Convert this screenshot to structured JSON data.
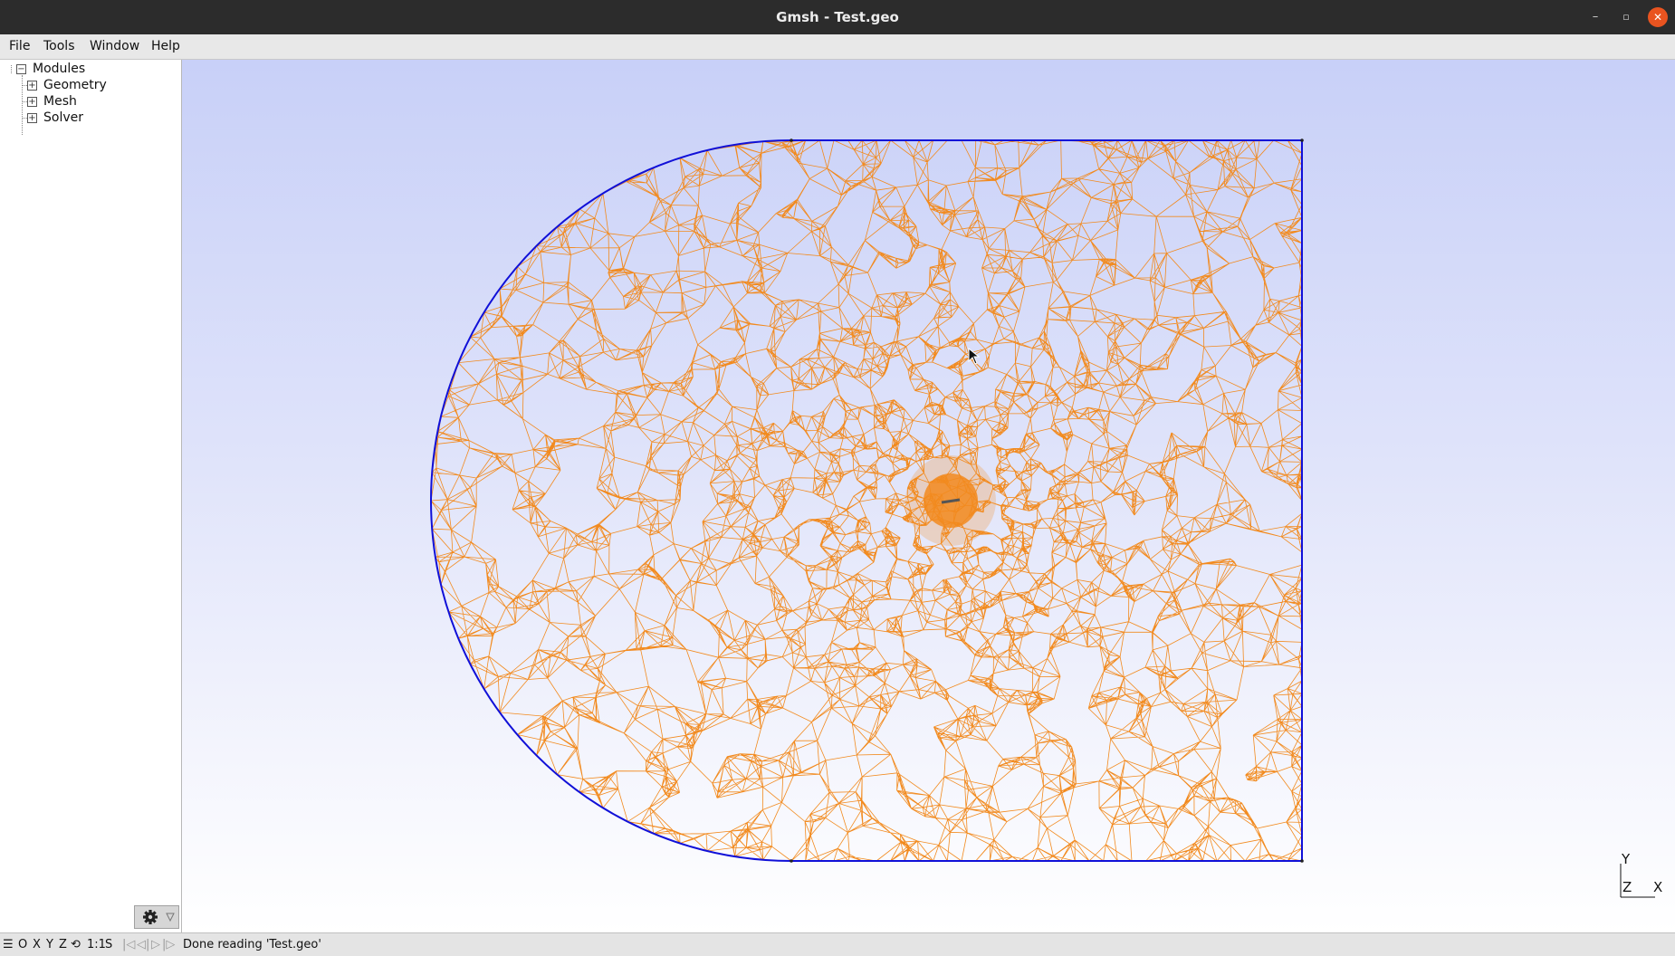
{
  "window": {
    "title": "Gmsh - Test.geo"
  },
  "window_controls": {
    "minimize": "–",
    "maximize": "▫",
    "close": "✕"
  },
  "menubar": [
    {
      "label": "File"
    },
    {
      "label": "Tools"
    },
    {
      "label": "Window"
    },
    {
      "label": "Help"
    }
  ],
  "tree": {
    "root": "Modules",
    "children": [
      "Geometry",
      "Mesh",
      "Solver"
    ]
  },
  "statusbar": {
    "menu_glyph": "☰",
    "origin": "O",
    "x": "X",
    "y": "Y",
    "z": "Z",
    "rotate_glyph": "⟲",
    "scale": "1:1",
    "s": "S",
    "first": "|◁",
    "prev": "◁|",
    "play": "▷",
    "last": "|▷",
    "message": "Done reading 'Test.geo'"
  },
  "axes": {
    "y": "Y",
    "z": "Z",
    "x": "X"
  },
  "colors": {
    "mesh": "#f28a1e",
    "boundary": "#1010d8",
    "background_top": "#c8d0f8",
    "background_bottom": "#ffffff",
    "close_button": "#e95420"
  }
}
